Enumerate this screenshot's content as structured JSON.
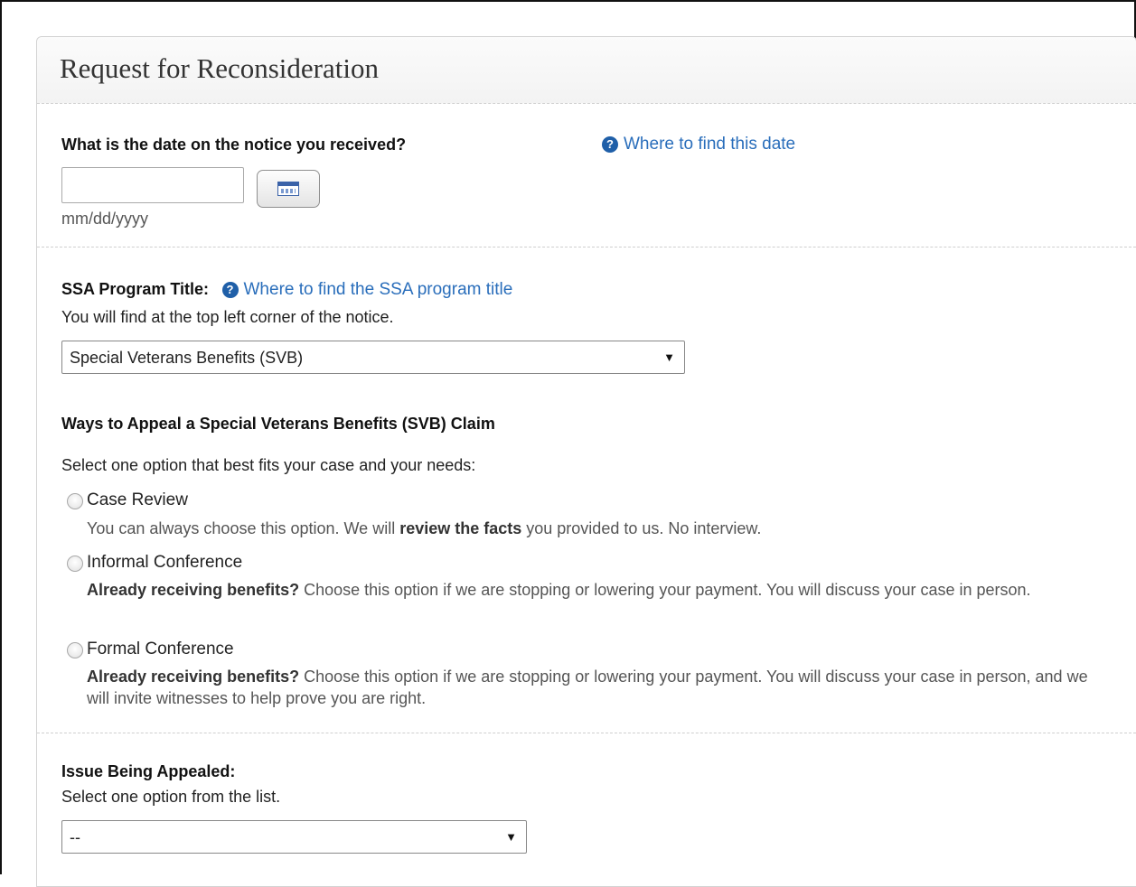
{
  "panel": {
    "title": "Request for Reconsideration"
  },
  "date_section": {
    "question": "What is the date on the notice you received?",
    "help_link": "Where to find this date",
    "input_value": "",
    "format_hint": "mm/dd/yyyy",
    "calendar_icon": "calendar-icon"
  },
  "program_section": {
    "label": "SSA Program Title:",
    "help_link": "Where to find the SSA program title",
    "hint": "You will find at the top left corner of the notice.",
    "selected": "Special Veterans Benefits (SVB)"
  },
  "appeal_section": {
    "heading": "Ways to Appeal a Special Veterans Benefits (SVB) Claim",
    "instruction": "Select one option that best fits your case and your needs:",
    "options": [
      {
        "label": "Case Review",
        "desc_pre": "You can always choose this option. We will ",
        "desc_bold": "review the facts",
        "desc_post": " you provided to us. No interview."
      },
      {
        "label": "Informal Conference",
        "desc_bold": "Already receiving benefits?",
        "desc_post": " Choose this option if we are stopping or lowering your payment. You will discuss your case in person."
      },
      {
        "label": "Formal Conference",
        "desc_bold": "Already receiving benefits?",
        "desc_post": " Choose this option if we are stopping or lowering your payment. You will discuss your case in person, and we will invite witnesses to help prove you are right."
      }
    ]
  },
  "issue_section": {
    "label": "Issue Being Appealed:",
    "hint": "Select one option from the list.",
    "selected": "--"
  },
  "colors": {
    "link": "#2a6ebb",
    "help_icon": "#1f5fa8"
  }
}
